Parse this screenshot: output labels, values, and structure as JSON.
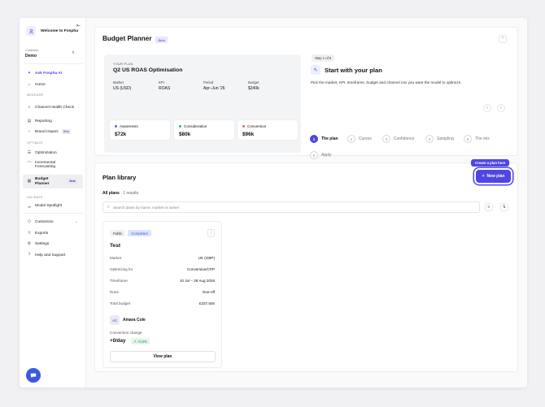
{
  "user": {
    "welcome": "Welcome to Fospha"
  },
  "customer": {
    "label": "Customer",
    "name": "Demo"
  },
  "nav": {
    "ask": "Ask Fospha AI",
    "home": "Home",
    "measure_section": "MEASURE",
    "channel_health": "Channel Health Check",
    "reporting": "Reporting",
    "brand_impact": "Brand Impact",
    "beta": "Beta",
    "optimize_section": "OPTIMIZE",
    "optimization": "Optimization",
    "incremental": "Incremental Forecasting",
    "budget_planner": "Budget Planner",
    "validate_section": "VALIDATE",
    "model_spotlight": "Model Spotlight",
    "customize": "Customize",
    "exports": "Exports",
    "settings": "Settings",
    "help": "Help and Support"
  },
  "header": {
    "title": "Budget Planner",
    "badge": "Beta"
  },
  "plan": {
    "your_plan_label": "YOUR PLAN",
    "title": "Q2 US ROAS Optimisation",
    "fields": [
      {
        "label": "Market",
        "value": "US (USD)"
      },
      {
        "label": "KPI",
        "value": "ROAS"
      },
      {
        "label": "Period",
        "value": "Apr–Jun '26"
      },
      {
        "label": "Budget",
        "value": "$240k"
      }
    ],
    "mix": [
      {
        "label": "Awareness",
        "value": "$72k",
        "color": "#5b5fe8"
      },
      {
        "label": "Consideration",
        "value": "$80k",
        "color": "#2fb47c"
      },
      {
        "label": "Conversion",
        "value": "$96k",
        "color": "#e06b6b"
      }
    ]
  },
  "onboarding": {
    "step_badge": "Step 1 of 6",
    "title": "Start with your plan",
    "description": "Pick the market, KPI, timeframe, budget and channel mix you want the model to optimize.",
    "steps": [
      {
        "num": "1",
        "label": "The plan"
      },
      {
        "num": "2",
        "label": "Curves"
      },
      {
        "num": "3",
        "label": "Confidence"
      },
      {
        "num": "4",
        "label": "Sampling"
      },
      {
        "num": "5",
        "label": "The mix"
      },
      {
        "num": "6",
        "label": "Apply"
      }
    ]
  },
  "library": {
    "title": "Plan library",
    "tooltip": "Create a plan here",
    "new_plan": "New plan",
    "all_plans": "All plans",
    "count": "· 1 results",
    "search_placeholder": "Search plans by name, market or owner"
  },
  "plan_card": {
    "tags": [
      "Public",
      "Completed"
    ],
    "name": "Test",
    "rows": [
      {
        "label": "Market",
        "value": "UK (GBP)"
      },
      {
        "label": "Optimizing for",
        "value": "Conversion/CPP"
      },
      {
        "label": "Timeframe",
        "value": "10 Jul – 29 Aug 2026"
      },
      {
        "label": "Runs",
        "value": "One-off"
      },
      {
        "label": "Total budget",
        "value": "£337,926"
      }
    ],
    "owner_initials": "AC",
    "owner_name": "Amara Cole",
    "change_label": "Conversion change",
    "change_value": "+0/day",
    "change_badge": "+0.0%",
    "view_button": "View plan"
  },
  "colors": {
    "accent": "#4f46e5",
    "active_nav": "#efeff2"
  }
}
